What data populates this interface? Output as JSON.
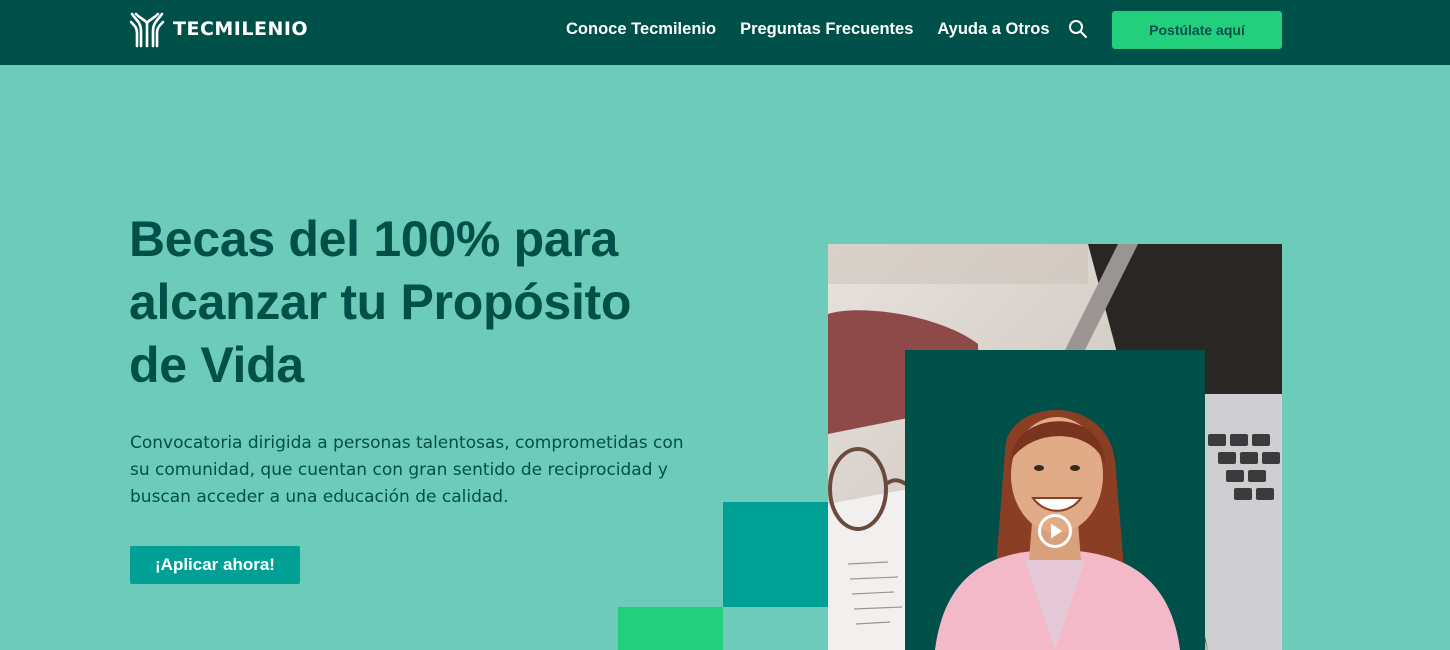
{
  "header": {
    "brand": "TECMILENIO",
    "nav": [
      "Conoce Tecmilenio",
      "Preguntas Frecuentes",
      "Ayuda a Otros"
    ],
    "cta_label": "Postúlate aquí"
  },
  "hero": {
    "title": "Becas del 100% para alcanzar tu Propósito de Vida",
    "description": "Convocatoria dirigida a personas talentosas, comprometidas con su comunidad, que cuentan con gran sentido de reciprocidad y buscan acceder a una educación de calidad.",
    "button_label": "¡Aplicar ahora!"
  },
  "icons": {
    "logo": "tecmilenio-logo-icon",
    "search": "search-icon",
    "play": "play-icon"
  },
  "colors": {
    "header_bg": "#00504a",
    "page_bg": "#6dcbba",
    "accent_green": "#22cf7d",
    "accent_teal": "#00a096"
  }
}
